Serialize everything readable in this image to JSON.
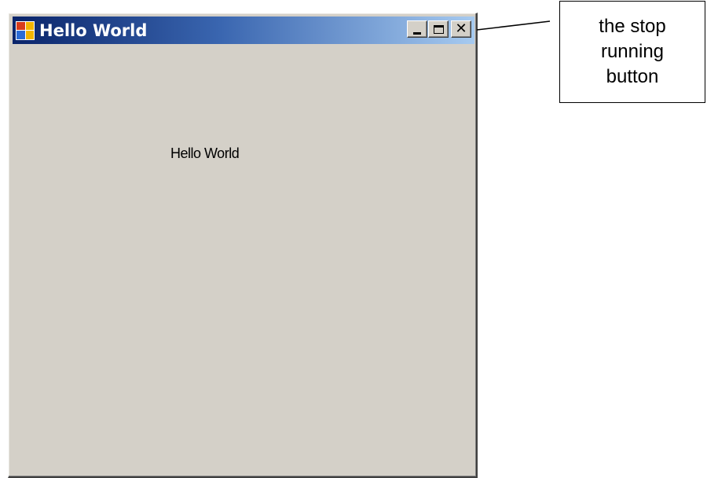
{
  "window": {
    "title": "Hello World",
    "client_text": "Hello World",
    "controls": {
      "minimize_icon": "minimize-icon",
      "maximize_icon": "maximize-icon",
      "close_icon": "close-icon",
      "close_glyph": "✕"
    },
    "colors": {
      "titlebar_start": "#0a246a",
      "titlebar_end": "#a6caf0",
      "face": "#d4d0c8"
    }
  },
  "annotation": {
    "text": "the stop running button"
  }
}
